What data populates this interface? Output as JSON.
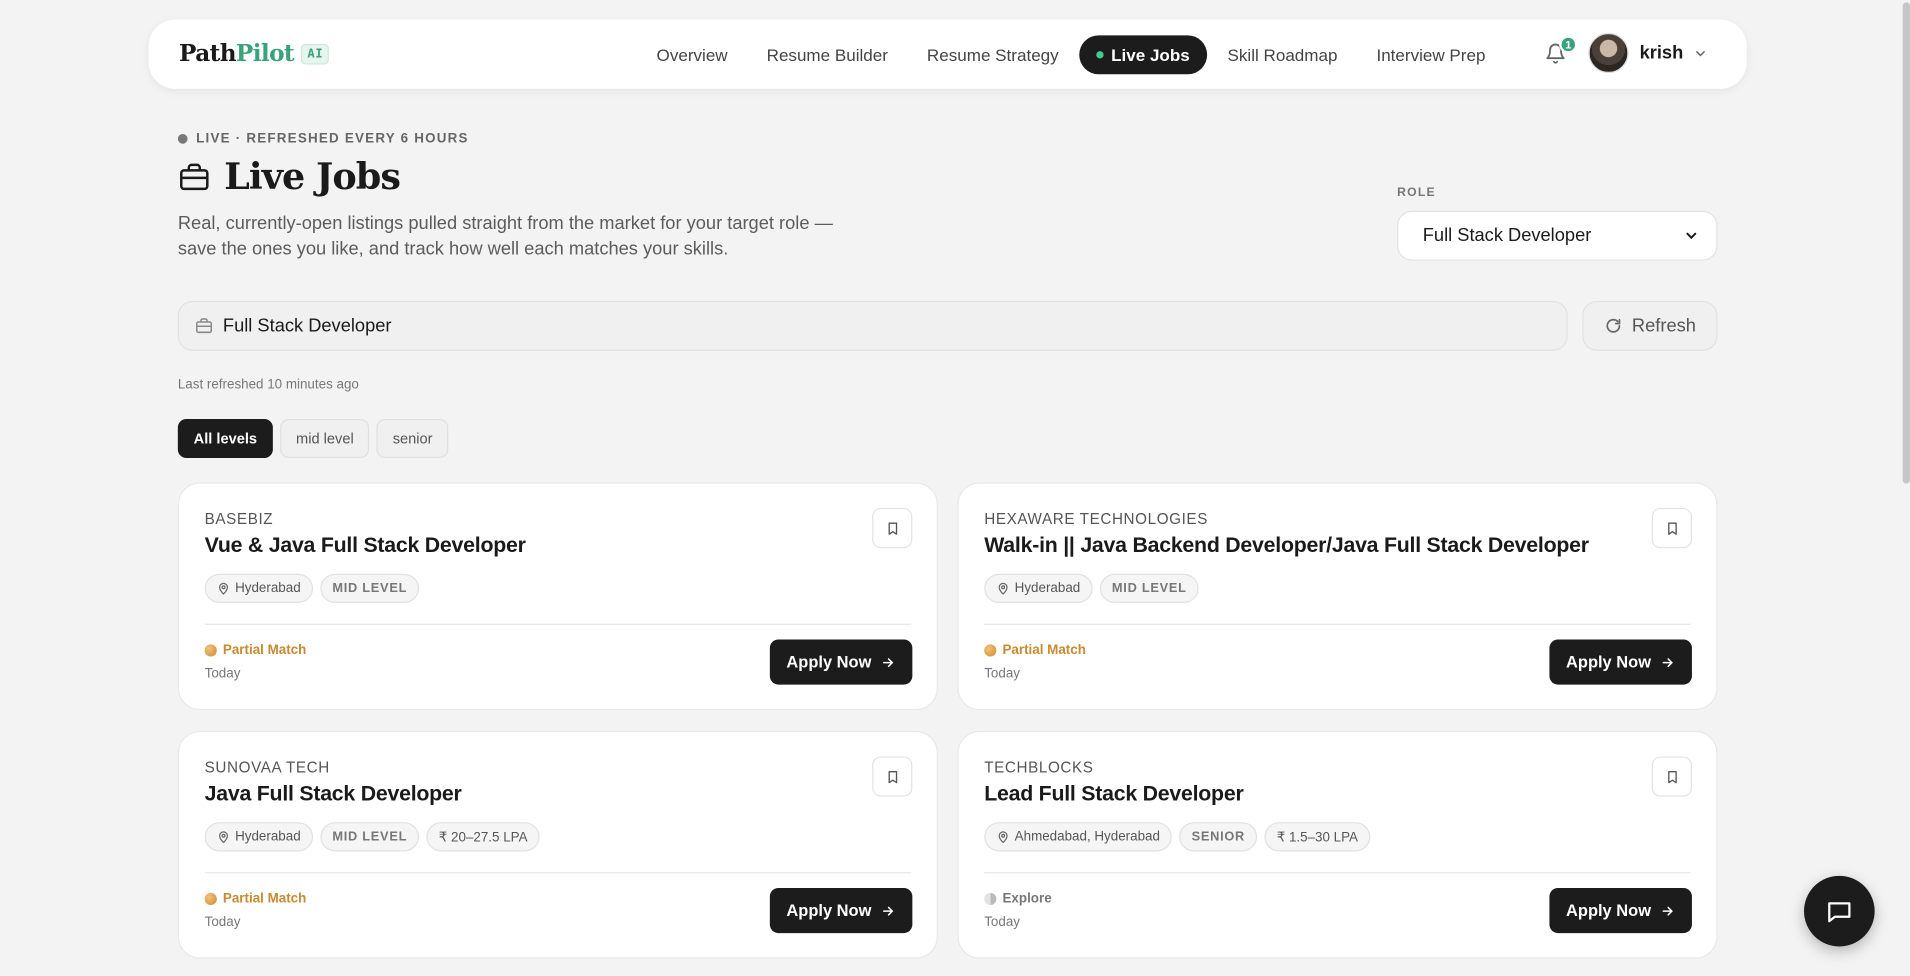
{
  "brand": {
    "part1": "Path",
    "part2": "Pilot",
    "badge": "AI"
  },
  "nav": {
    "links": [
      "Overview",
      "Resume Builder",
      "Resume Strategy",
      "Live Jobs",
      "Skill Roadmap",
      "Interview Prep"
    ],
    "active": "Live Jobs"
  },
  "notifications": {
    "count": "1"
  },
  "user": {
    "name": "krish"
  },
  "header": {
    "live_tag": "LIVE · REFRESHED EVERY 6 HOURS",
    "title": "Live Jobs",
    "subtitle": "Real, currently-open listings pulled straight from the market for your target role — save the ones you like, and track how well each matches your skills."
  },
  "role": {
    "label": "ROLE",
    "selected": "Full Stack Developer"
  },
  "search": {
    "value": "Full Stack Developer"
  },
  "refresh": {
    "label": "Refresh"
  },
  "last_refreshed": "Last refreshed 10 minutes ago",
  "filters": {
    "items": [
      "All levels",
      "mid level",
      "senior"
    ],
    "active": "All levels"
  },
  "jobs": [
    {
      "company": "BASEBIZ",
      "title": "Vue & Java Full Stack Developer",
      "location": "Hyderabad",
      "level": "MID LEVEL",
      "salary": "",
      "match": "Partial Match",
      "match_type": "partial",
      "posted": "Today",
      "apply": "Apply Now"
    },
    {
      "company": "HEXAWARE TECHNOLOGIES",
      "title": "Walk-in || Java Backend Developer/Java Full Stack Developer",
      "location": "Hyderabad",
      "level": "MID LEVEL",
      "salary": "",
      "match": "Partial Match",
      "match_type": "partial",
      "posted": "Today",
      "apply": "Apply Now"
    },
    {
      "company": "SUNOVAA TECH",
      "title": "Java Full Stack Developer",
      "location": "Hyderabad",
      "level": "MID LEVEL",
      "salary": "₹ 20–27.5 LPA",
      "match": "Partial Match",
      "match_type": "partial",
      "posted": "Today",
      "apply": "Apply Now"
    },
    {
      "company": "TECHBLOCKS",
      "title": "Lead Full Stack Developer",
      "location": "Ahmedabad, Hyderabad",
      "level": "SENIOR",
      "salary": "₹ 1.5–30 LPA",
      "match": "Explore",
      "match_type": "explore",
      "posted": "Today",
      "apply": "Apply Now"
    }
  ],
  "colors": {
    "accent": "#3aa27a",
    "dark": "#1c1c1c",
    "partial_match": "#c98a2f",
    "background": "#f3f3f4"
  }
}
